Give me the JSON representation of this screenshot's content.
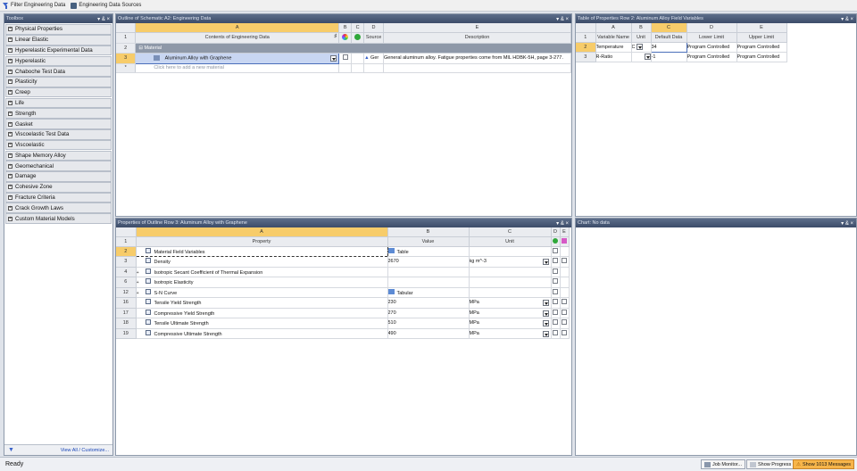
{
  "topbar": {
    "filter_label": "Filter Engineering Data",
    "sources_label": "Engineering Data Sources"
  },
  "toolbox": {
    "title": "Toolbox",
    "controls": "▾ & ×",
    "items": [
      "Physical Properties",
      "Linear Elastic",
      "Hyperelastic Experimental Data",
      "Hyperelastic",
      "Chaboche Test Data",
      "Plasticity",
      "Creep",
      "Life",
      "Strength",
      "Gasket",
      "Viscoelastic Test Data",
      "Viscoelastic",
      "Shape Memory Alloy",
      "Geomechanical",
      "Damage",
      "Cohesive Zone",
      "Fracture Criteria",
      "Crack Growth Laws",
      "Custom Material Models"
    ],
    "view_all": "View All / Customize..."
  },
  "outline": {
    "title": "Outline of Schematic A2: Engineering Data",
    "controls": "▾ & ×",
    "columns": [
      "A",
      "B",
      "C",
      "D",
      "E"
    ],
    "header": {
      "contents": "Contents of Engineering Data",
      "source": "Source",
      "description": "Description"
    },
    "rows": [
      {
        "num": "1"
      },
      {
        "num": "2",
        "label": "Material"
      },
      {
        "num": "3",
        "name": "Aluminum Alloy with Graphene",
        "source": "Ger",
        "description": "General aluminum alloy. Fatigue properties come from MIL HDBK-5H, page 3-277."
      },
      {
        "num": "*",
        "name": "Click here to add a new material"
      }
    ]
  },
  "field_vars": {
    "title": "Table of Properties Row 2: Aluminum Alloy Field Variables",
    "controls": "▾ & ×",
    "columns": [
      "A",
      "B",
      "C",
      "D",
      "E"
    ],
    "headers": [
      "Variable Name",
      "Unit",
      "Default Data",
      "Lower Limit",
      "Upper Limit"
    ],
    "rows": [
      {
        "num": "2",
        "name": "Temperature",
        "unit": "C",
        "default": "34",
        "lower": "Program Controlled",
        "upper": "Program Controlled"
      },
      {
        "num": "3",
        "name": "R-Ratio",
        "unit": "",
        "default": "-1",
        "lower": "Program Controlled",
        "upper": "Program Controlled"
      }
    ]
  },
  "properties": {
    "title": "Properties of Outline Row 3: Aluminum Alloy with Graphene",
    "controls": "▾ & ×",
    "columns": [
      "A",
      "B",
      "C",
      "D",
      "E"
    ],
    "headers": [
      "Property",
      "Value",
      "Unit"
    ],
    "rows": [
      {
        "num": "2",
        "expand": "",
        "name": "Material Field Variables",
        "value": "Table",
        "unit": "",
        "icon": "table"
      },
      {
        "num": "3",
        "expand": "",
        "name": "Density",
        "value": "2670",
        "unit": "kg m^-3",
        "icon": ""
      },
      {
        "num": "4",
        "expand": "+",
        "name": "Isotropic Secant Coefficient of Thermal Expansion",
        "value": "",
        "unit": "",
        "icon": ""
      },
      {
        "num": "6",
        "expand": "+",
        "name": "Isotropic Elasticity",
        "value": "",
        "unit": "",
        "icon": ""
      },
      {
        "num": "12",
        "expand": "+",
        "name": "S-N Curve",
        "value": "Tabular",
        "unit": "",
        "icon": "table"
      },
      {
        "num": "16",
        "expand": "",
        "name": "Tensile Yield Strength",
        "value": "230",
        "unit": "MPa",
        "icon": ""
      },
      {
        "num": "17",
        "expand": "",
        "name": "Compressive Yield Strength",
        "value": "270",
        "unit": "MPa",
        "icon": ""
      },
      {
        "num": "18",
        "expand": "",
        "name": "Tensile Ultimate Strength",
        "value": "510",
        "unit": "MPa",
        "icon": ""
      },
      {
        "num": "19",
        "expand": "",
        "name": "Compressive Ultimate Strength",
        "value": "490",
        "unit": "MPa",
        "icon": ""
      }
    ]
  },
  "chart": {
    "title": "Chart: No data",
    "controls": "▾ & ×"
  },
  "status": {
    "ready": "Ready",
    "job_monitor": "Job Monitor...",
    "show_progress": "Show Progress",
    "messages": "Show 1013 Messages"
  }
}
